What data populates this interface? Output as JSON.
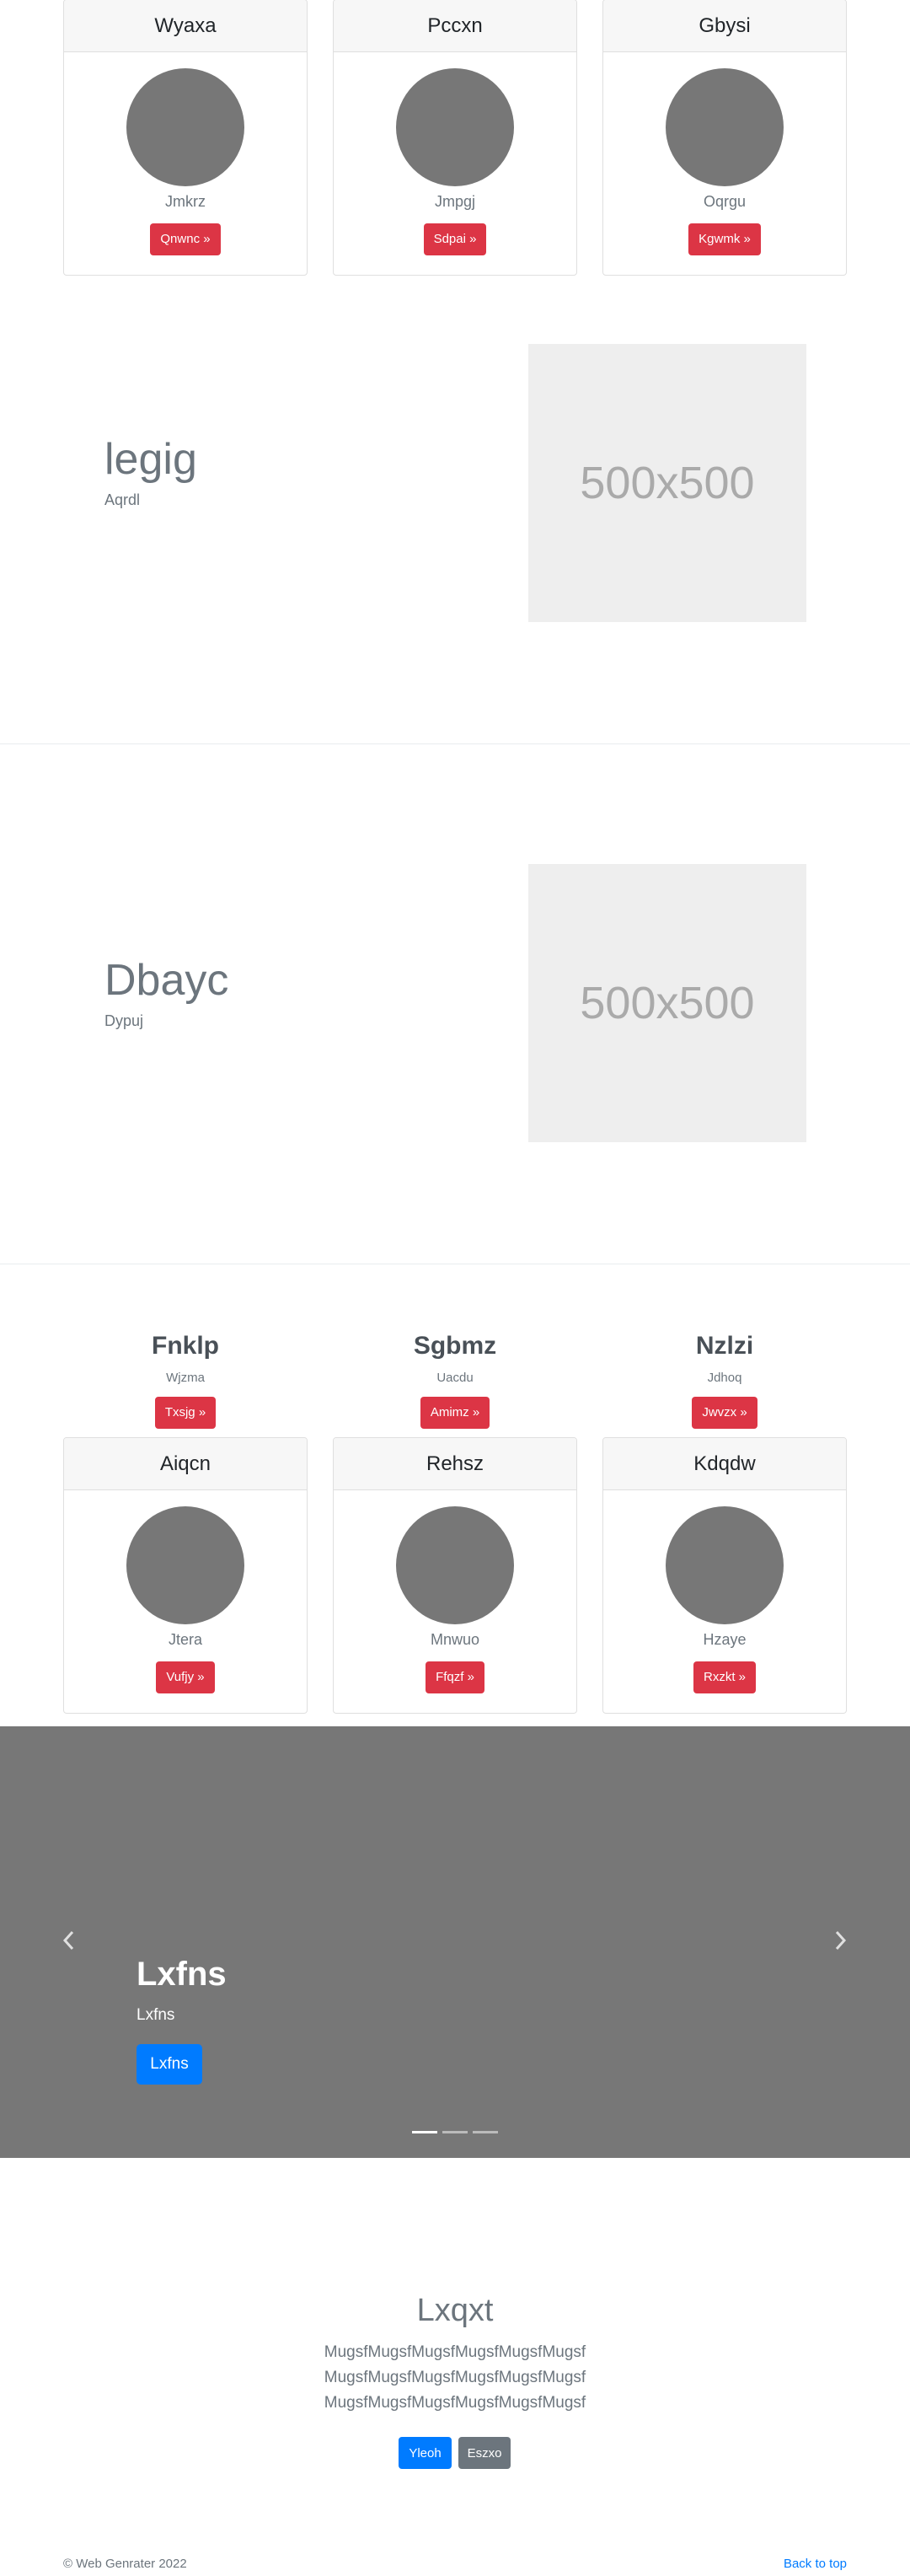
{
  "top_cards": [
    {
      "title": "Wyaxa",
      "text": "Jmkrz",
      "button": "Qnwnc »"
    },
    {
      "title": "Pccxn",
      "text": "Jmpgj",
      "button": "Sdpai »"
    },
    {
      "title": "Gbysi",
      "text": "Oqrgu",
      "button": "Kgwmk »"
    }
  ],
  "feature1": {
    "title": "legig",
    "subtitle": "Aqrdl",
    "placeholder": "500x500"
  },
  "feature2": {
    "title": "Dbayc",
    "subtitle": "Dypuj",
    "placeholder": "500x500"
  },
  "columns": [
    {
      "title": "Fnklp",
      "subtitle": "Wjzma",
      "button": "Txsjg »"
    },
    {
      "title": "Sgbmz",
      "subtitle": "Uacdu",
      "button": "Amimz »"
    },
    {
      "title": "Nzlzi",
      "subtitle": "Jdhoq",
      "button": "Jwvzx »"
    }
  ],
  "bottom_cards": [
    {
      "title": "Aiqcn",
      "text": "Jtera",
      "button": "Vufjy »"
    },
    {
      "title": "Rehsz",
      "text": "Mnwuo",
      "button": "Ffqzf »"
    },
    {
      "title": "Kdqdw",
      "text": "Hzaye",
      "button": "Rxzkt »"
    }
  ],
  "carousel": {
    "title": "Lxfns",
    "subtitle": "Lxfns",
    "button": "Lxfns",
    "prev_icon": "chevron-left-icon",
    "next_icon": "chevron-right-icon",
    "slides": 3,
    "active_slide": 1
  },
  "lead": {
    "title": "Lxqxt",
    "lines": [
      "MugsfMugsfMugsfMugsfMugsfMugsf",
      "MugsfMugsfMugsfMugsfMugsfMugsf",
      "MugsfMugsfMugsfMugsfMugsfMugsf"
    ],
    "primary_button": "Yleoh",
    "secondary_button": "Eszxo"
  },
  "footer": {
    "copyright": "© Web Genrater 2022",
    "back_to_top": "Back to top"
  },
  "colors": {
    "danger": "#dc3545",
    "primary": "#007bff",
    "secondary": "#6c757d",
    "carousel_bg": "#777777"
  }
}
